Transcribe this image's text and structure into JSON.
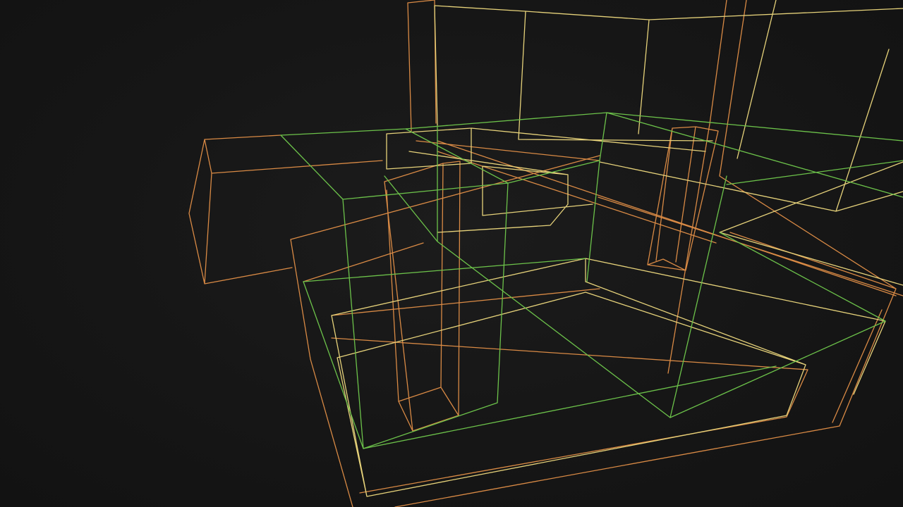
{
  "scene": {
    "view": "wireframe",
    "background_color": "#161616",
    "edge_colors": {
      "orange": "#d98a45",
      "yellow": "#e6d27a",
      "green": "#6cc24a"
    }
  }
}
